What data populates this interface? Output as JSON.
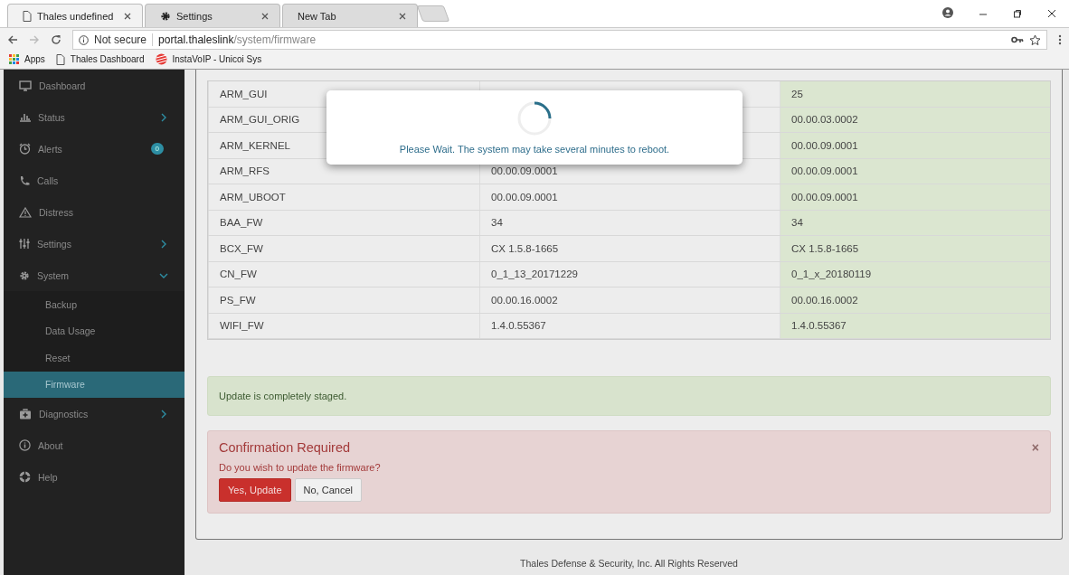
{
  "browser": {
    "tabs": [
      {
        "title": "Thales undefined",
        "selected": true
      },
      {
        "title": "Settings",
        "selected": false
      },
      {
        "title": "New Tab",
        "selected": false
      }
    ],
    "address": {
      "security": "Not secure",
      "host": "portal.thaleslink",
      "path": "/system/firmware"
    },
    "bookmarks": [
      {
        "label": "Apps"
      },
      {
        "label": "Thales Dashboard"
      },
      {
        "label": "InstaVoIP - Unicoi Sys"
      }
    ]
  },
  "sidebar": {
    "items": [
      {
        "label": "Dashboard",
        "kind": "link",
        "selected": false
      },
      {
        "label": "Status",
        "kind": "group",
        "expanded": false,
        "selected": false
      },
      {
        "label": "Alerts",
        "kind": "link",
        "badge": "0",
        "selected": false
      },
      {
        "label": "Calls",
        "kind": "link",
        "selected": false
      },
      {
        "label": "Distress",
        "kind": "link",
        "selected": false
      },
      {
        "label": "Settings",
        "kind": "group",
        "expanded": false,
        "selected": false
      },
      {
        "label": "System",
        "kind": "group",
        "expanded": true,
        "selected": false,
        "children": [
          {
            "label": "Backup",
            "selected": false
          },
          {
            "label": "Data Usage",
            "selected": false
          },
          {
            "label": "Reset",
            "selected": false
          },
          {
            "label": "Firmware",
            "selected": true
          }
        ]
      },
      {
        "label": "Diagnostics",
        "kind": "group",
        "expanded": false,
        "selected": false
      },
      {
        "label": "About",
        "kind": "link",
        "selected": false
      },
      {
        "label": "Help",
        "kind": "link",
        "selected": false
      }
    ]
  },
  "table": {
    "rows": [
      {
        "name": "ARM_GUI",
        "staged": "25"
      },
      {
        "name": "ARM_GUI_ORIG",
        "staged": "00.00.03.0002"
      },
      {
        "name": "ARM_KERNEL",
        "staged": "00.00.09.0001"
      },
      {
        "name": "ARM_RFS",
        "current": "00.00.09.0001",
        "staged": "00.00.09.0001"
      },
      {
        "name": "ARM_UBOOT",
        "current": "00.00.09.0001",
        "staged": "00.00.09.0001"
      },
      {
        "name": "BAA_FW",
        "current": "34",
        "staged": "34"
      },
      {
        "name": "BCX_FW",
        "current": "CX 1.5.8-1665",
        "staged": "CX 1.5.8-1665"
      },
      {
        "name": "CN_FW",
        "current": "0_1_13_20171229",
        "staged": "0_1_x_20180119"
      },
      {
        "name": "PS_FW",
        "current": "00.00.16.0002",
        "staged": "00.00.16.0002"
      },
      {
        "name": "WIFI_FW",
        "current": "1.4.0.55367",
        "staged": "1.4.0.55367"
      }
    ]
  },
  "success_alert": {
    "message": "Update is completely staged."
  },
  "confirm_alert": {
    "title": "Confirmation Required",
    "message": "Do you wish to update the firmware?",
    "close": "×",
    "buttons": [
      {
        "label": "Yes, Update",
        "kind": "danger"
      },
      {
        "label": "No, Cancel",
        "kind": "default"
      }
    ]
  },
  "modal": {
    "message": "Please Wait. The system may take several minutes to reboot."
  },
  "footer": "Thales Defense & Security, Inc. All Rights Reserved"
}
